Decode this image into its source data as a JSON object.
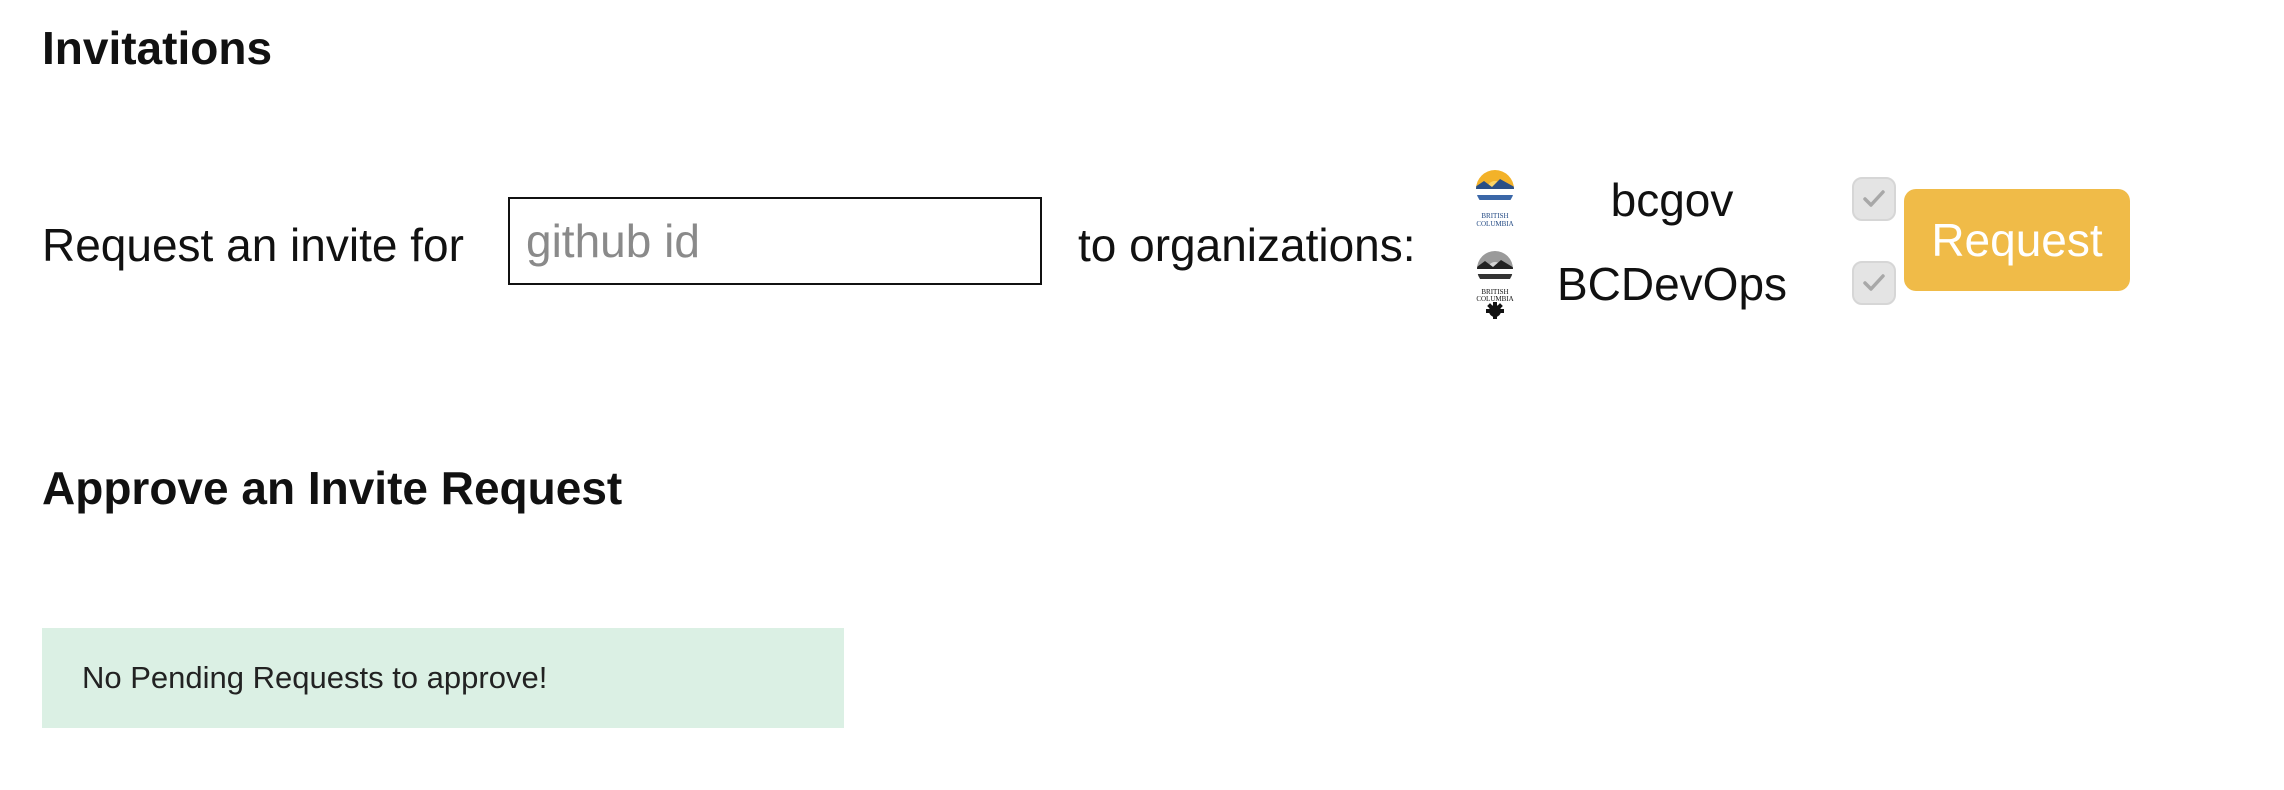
{
  "invitations": {
    "title": "Invitations",
    "request_label": "Request an invite for",
    "github_input": {
      "placeholder": "github id",
      "value": ""
    },
    "organizations_label": "to organizations:",
    "organizations": [
      {
        "name": "bcgov",
        "checked": true,
        "logo": "british-columbia-logo"
      },
      {
        "name": "BCDevOps",
        "checked": true,
        "logo": "bc-devops-logo"
      }
    ],
    "request_button": "Request",
    "accent_color": "#f0bb48"
  },
  "approve": {
    "title": "Approve an Invite Request",
    "empty_message": "No Pending Requests to approve!",
    "notice_color": "#dbf0e4"
  }
}
